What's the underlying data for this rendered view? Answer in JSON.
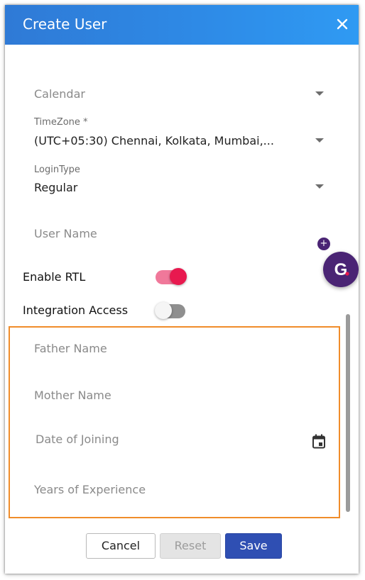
{
  "dialog": {
    "title": "Create User",
    "close_icon": "close-icon"
  },
  "fields": {
    "calendar": {
      "placeholder": "Calendar"
    },
    "timezone": {
      "label": "TimeZone *",
      "value": "(UTC+05:30) Chennai, Kolkata, Mumbai,..."
    },
    "login_type": {
      "label": "LoginType",
      "value": "Regular"
    },
    "user_name": {
      "placeholder": "User Name"
    },
    "father_name": {
      "placeholder": "Father Name"
    },
    "mother_name": {
      "placeholder": "Mother Name"
    },
    "date_of_joining": {
      "placeholder": "Date of Joining",
      "icon": "calendar-icon"
    },
    "years_of_experience": {
      "placeholder": "Years of Experience"
    }
  },
  "toggles": {
    "enable_rtl": {
      "label": "Enable RTL",
      "on": true
    },
    "integration_access": {
      "label": "Integration Access",
      "on": false
    }
  },
  "buttons": {
    "cancel": "Cancel",
    "reset": "Reset",
    "save": "Save"
  },
  "grammarly": {
    "letter": "G",
    "plus": "+"
  },
  "colors": {
    "header_start": "#2f7ad6",
    "header_end": "#2f9af3",
    "toggle_on_track": "#f0789a",
    "toggle_on_knob": "#e8194f",
    "toggle_off_track": "#8f8f8f",
    "toggle_off_knob": "#f5f5f5",
    "highlight": "#f08c2a",
    "save_button": "#2f4fb3",
    "grammarly_badge": "#4a2474"
  }
}
